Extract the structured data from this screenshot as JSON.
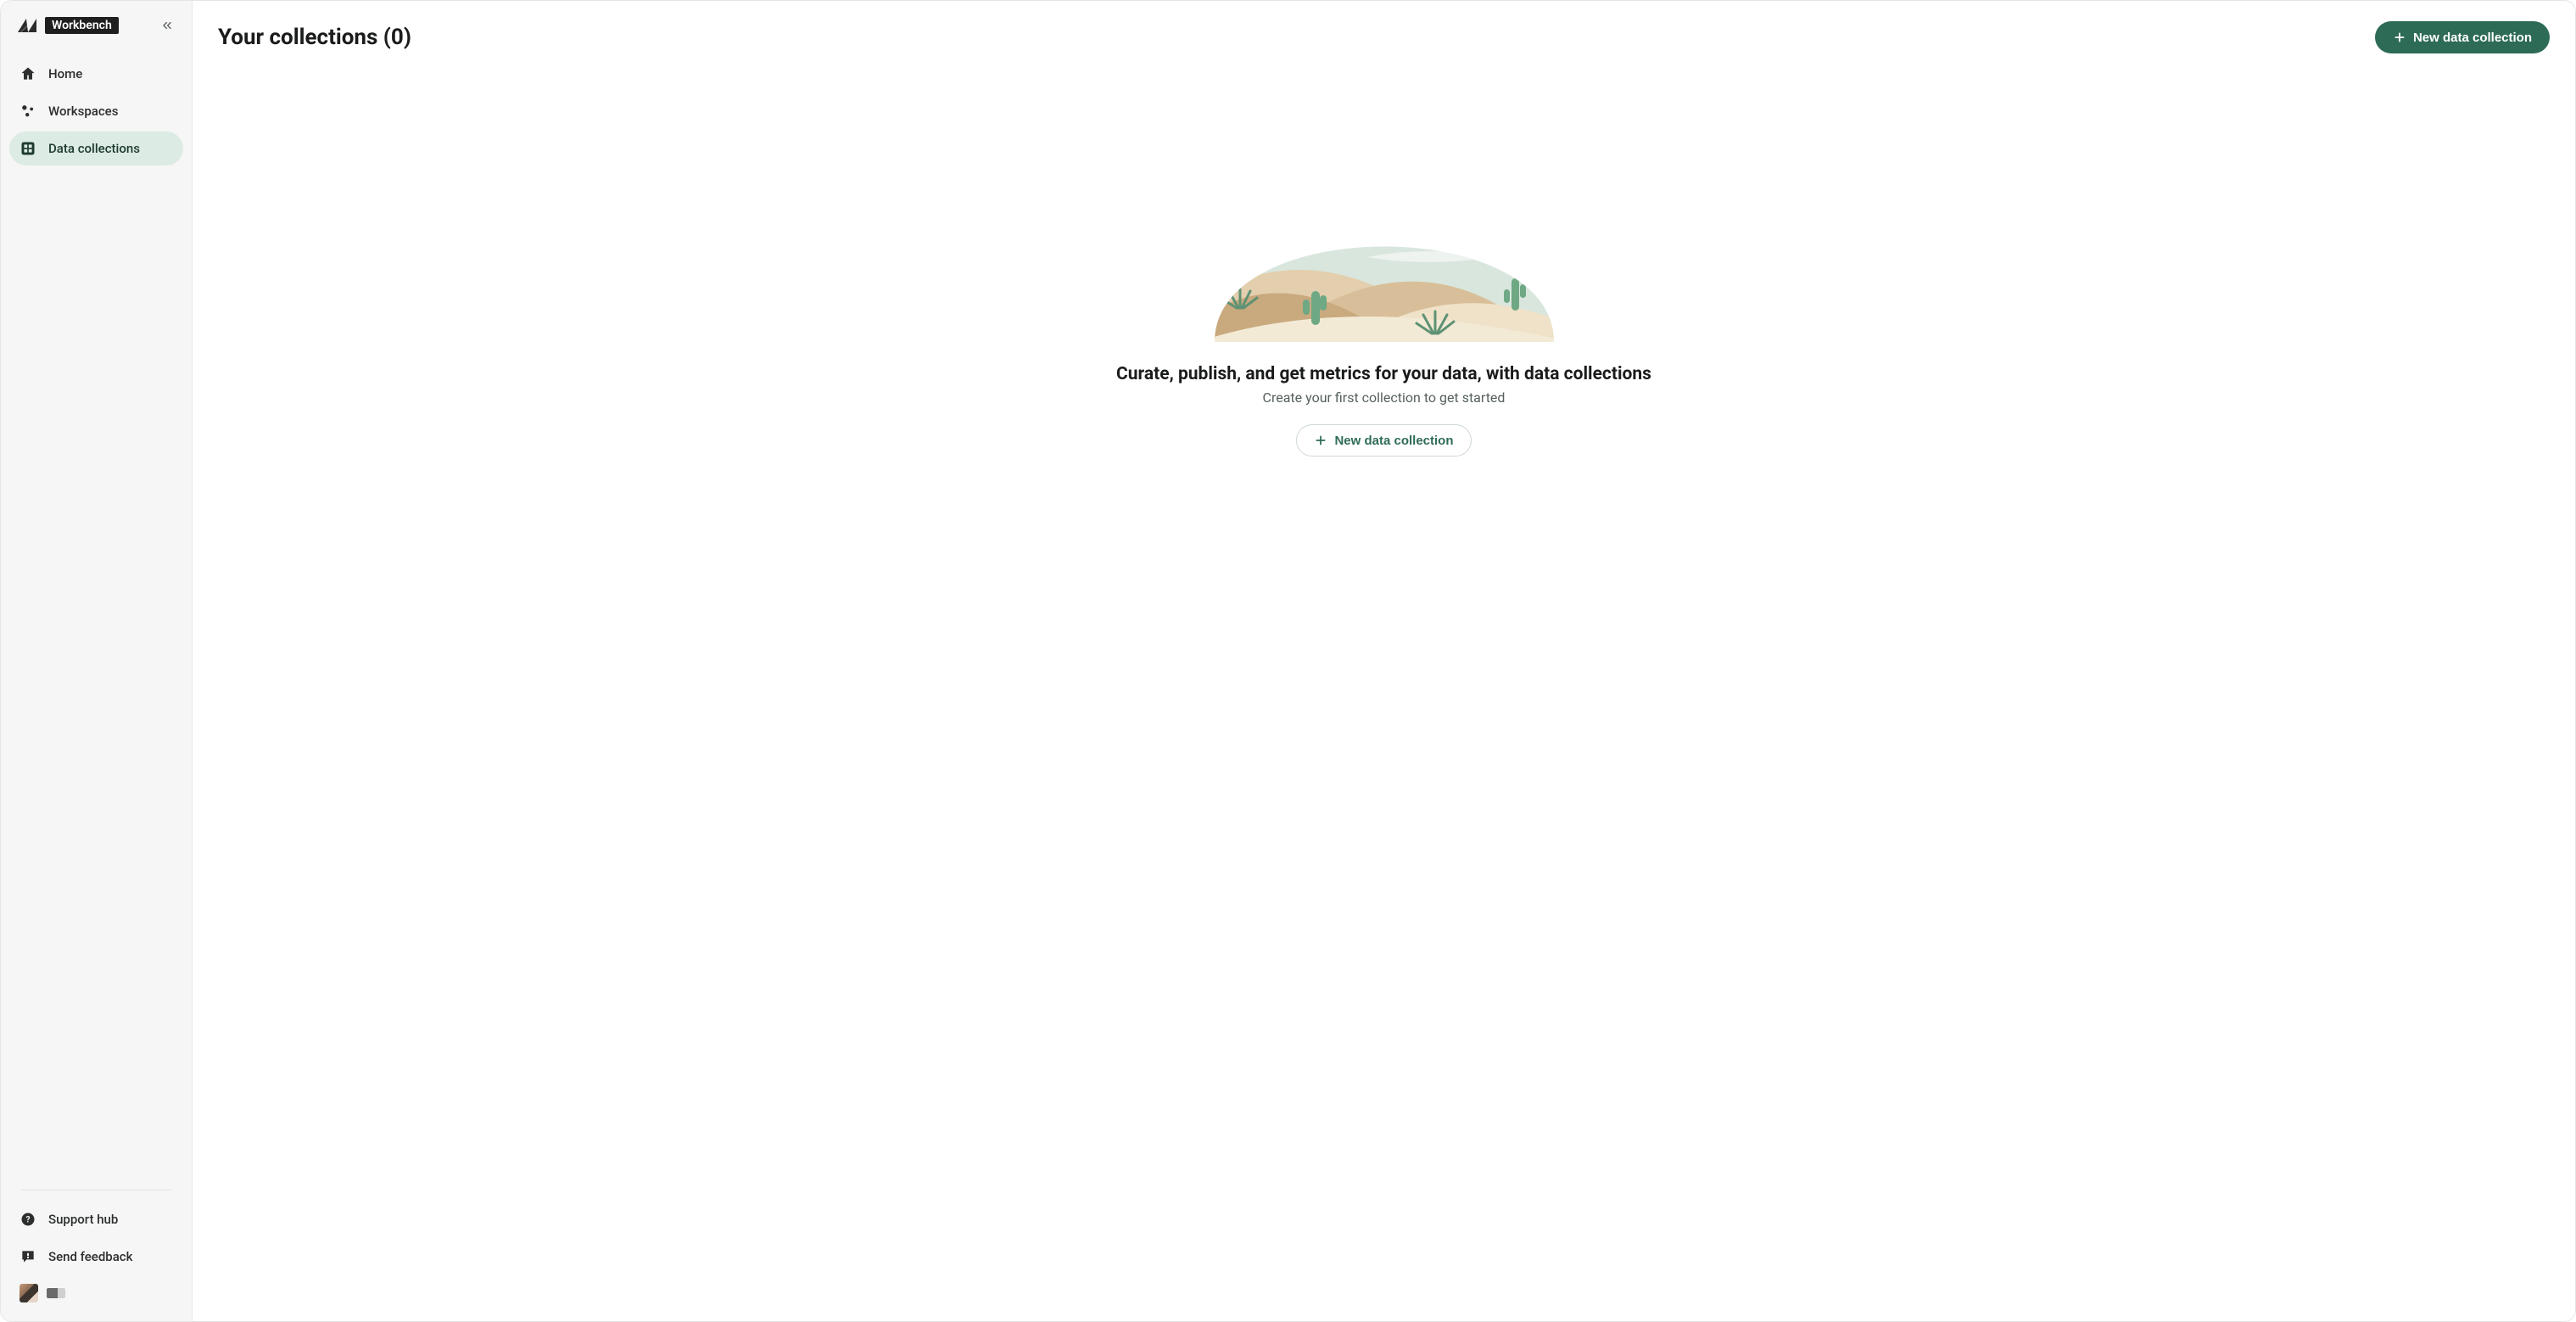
{
  "brand": {
    "name": "Workbench"
  },
  "sidebar": {
    "items": [
      {
        "id": "home",
        "label": "Home",
        "icon": "home-icon",
        "active": false
      },
      {
        "id": "workspaces",
        "label": "Workspaces",
        "icon": "workspaces-icon",
        "active": false
      },
      {
        "id": "data-collections",
        "label": "Data collections",
        "icon": "grid-icon",
        "active": true
      }
    ],
    "footer_items": [
      {
        "id": "support-hub",
        "label": "Support hub",
        "icon": "help-icon"
      },
      {
        "id": "send-feedback",
        "label": "Send feedback",
        "icon": "feedback-icon"
      }
    ]
  },
  "header": {
    "title": "Your collections (0)",
    "primary_button_label": "New data collection"
  },
  "empty_state": {
    "headline": "Curate, publish, and get metrics for your data, with data collections",
    "subline": "Create your first collection to get started",
    "cta_label": "New data collection"
  },
  "colors": {
    "accent": "#2e6b57",
    "sidebar_bg": "#f5f6f5",
    "active_bg": "#dcebe3"
  }
}
